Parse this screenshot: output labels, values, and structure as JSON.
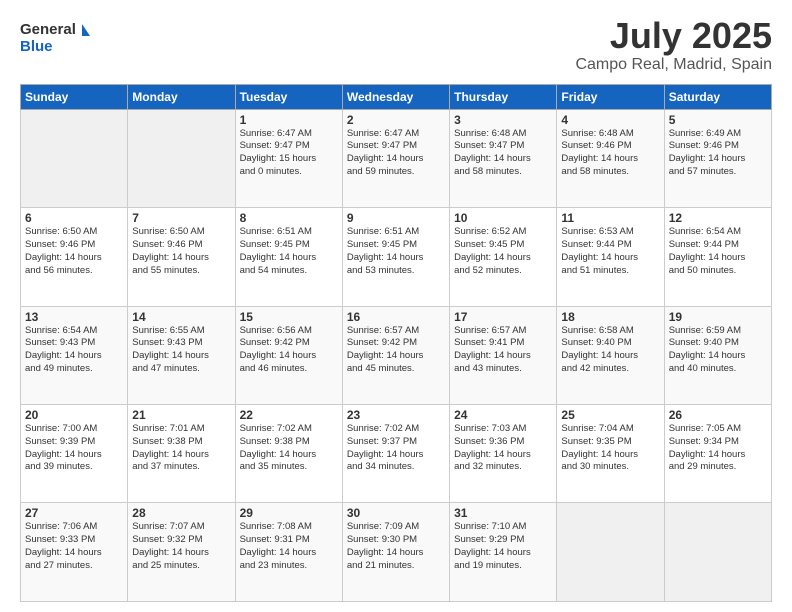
{
  "header": {
    "logo_line1": "General",
    "logo_line2": "Blue",
    "main_title": "July 2025",
    "subtitle": "Campo Real, Madrid, Spain"
  },
  "weekdays": [
    "Sunday",
    "Monday",
    "Tuesday",
    "Wednesday",
    "Thursday",
    "Friday",
    "Saturday"
  ],
  "weeks": [
    [
      {
        "day": "",
        "detail": ""
      },
      {
        "day": "",
        "detail": ""
      },
      {
        "day": "1",
        "detail": "Sunrise: 6:47 AM\nSunset: 9:47 PM\nDaylight: 15 hours\nand 0 minutes."
      },
      {
        "day": "2",
        "detail": "Sunrise: 6:47 AM\nSunset: 9:47 PM\nDaylight: 14 hours\nand 59 minutes."
      },
      {
        "day": "3",
        "detail": "Sunrise: 6:48 AM\nSunset: 9:47 PM\nDaylight: 14 hours\nand 58 minutes."
      },
      {
        "day": "4",
        "detail": "Sunrise: 6:48 AM\nSunset: 9:46 PM\nDaylight: 14 hours\nand 58 minutes."
      },
      {
        "day": "5",
        "detail": "Sunrise: 6:49 AM\nSunset: 9:46 PM\nDaylight: 14 hours\nand 57 minutes."
      }
    ],
    [
      {
        "day": "6",
        "detail": "Sunrise: 6:50 AM\nSunset: 9:46 PM\nDaylight: 14 hours\nand 56 minutes."
      },
      {
        "day": "7",
        "detail": "Sunrise: 6:50 AM\nSunset: 9:46 PM\nDaylight: 14 hours\nand 55 minutes."
      },
      {
        "day": "8",
        "detail": "Sunrise: 6:51 AM\nSunset: 9:45 PM\nDaylight: 14 hours\nand 54 minutes."
      },
      {
        "day": "9",
        "detail": "Sunrise: 6:51 AM\nSunset: 9:45 PM\nDaylight: 14 hours\nand 53 minutes."
      },
      {
        "day": "10",
        "detail": "Sunrise: 6:52 AM\nSunset: 9:45 PM\nDaylight: 14 hours\nand 52 minutes."
      },
      {
        "day": "11",
        "detail": "Sunrise: 6:53 AM\nSunset: 9:44 PM\nDaylight: 14 hours\nand 51 minutes."
      },
      {
        "day": "12",
        "detail": "Sunrise: 6:54 AM\nSunset: 9:44 PM\nDaylight: 14 hours\nand 50 minutes."
      }
    ],
    [
      {
        "day": "13",
        "detail": "Sunrise: 6:54 AM\nSunset: 9:43 PM\nDaylight: 14 hours\nand 49 minutes."
      },
      {
        "day": "14",
        "detail": "Sunrise: 6:55 AM\nSunset: 9:43 PM\nDaylight: 14 hours\nand 47 minutes."
      },
      {
        "day": "15",
        "detail": "Sunrise: 6:56 AM\nSunset: 9:42 PM\nDaylight: 14 hours\nand 46 minutes."
      },
      {
        "day": "16",
        "detail": "Sunrise: 6:57 AM\nSunset: 9:42 PM\nDaylight: 14 hours\nand 45 minutes."
      },
      {
        "day": "17",
        "detail": "Sunrise: 6:57 AM\nSunset: 9:41 PM\nDaylight: 14 hours\nand 43 minutes."
      },
      {
        "day": "18",
        "detail": "Sunrise: 6:58 AM\nSunset: 9:40 PM\nDaylight: 14 hours\nand 42 minutes."
      },
      {
        "day": "19",
        "detail": "Sunrise: 6:59 AM\nSunset: 9:40 PM\nDaylight: 14 hours\nand 40 minutes."
      }
    ],
    [
      {
        "day": "20",
        "detail": "Sunrise: 7:00 AM\nSunset: 9:39 PM\nDaylight: 14 hours\nand 39 minutes."
      },
      {
        "day": "21",
        "detail": "Sunrise: 7:01 AM\nSunset: 9:38 PM\nDaylight: 14 hours\nand 37 minutes."
      },
      {
        "day": "22",
        "detail": "Sunrise: 7:02 AM\nSunset: 9:38 PM\nDaylight: 14 hours\nand 35 minutes."
      },
      {
        "day": "23",
        "detail": "Sunrise: 7:02 AM\nSunset: 9:37 PM\nDaylight: 14 hours\nand 34 minutes."
      },
      {
        "day": "24",
        "detail": "Sunrise: 7:03 AM\nSunset: 9:36 PM\nDaylight: 14 hours\nand 32 minutes."
      },
      {
        "day": "25",
        "detail": "Sunrise: 7:04 AM\nSunset: 9:35 PM\nDaylight: 14 hours\nand 30 minutes."
      },
      {
        "day": "26",
        "detail": "Sunrise: 7:05 AM\nSunset: 9:34 PM\nDaylight: 14 hours\nand 29 minutes."
      }
    ],
    [
      {
        "day": "27",
        "detail": "Sunrise: 7:06 AM\nSunset: 9:33 PM\nDaylight: 14 hours\nand 27 minutes."
      },
      {
        "day": "28",
        "detail": "Sunrise: 7:07 AM\nSunset: 9:32 PM\nDaylight: 14 hours\nand 25 minutes."
      },
      {
        "day": "29",
        "detail": "Sunrise: 7:08 AM\nSunset: 9:31 PM\nDaylight: 14 hours\nand 23 minutes."
      },
      {
        "day": "30",
        "detail": "Sunrise: 7:09 AM\nSunset: 9:30 PM\nDaylight: 14 hours\nand 21 minutes."
      },
      {
        "day": "31",
        "detail": "Sunrise: 7:10 AM\nSunset: 9:29 PM\nDaylight: 14 hours\nand 19 minutes."
      },
      {
        "day": "",
        "detail": ""
      },
      {
        "day": "",
        "detail": ""
      }
    ]
  ]
}
